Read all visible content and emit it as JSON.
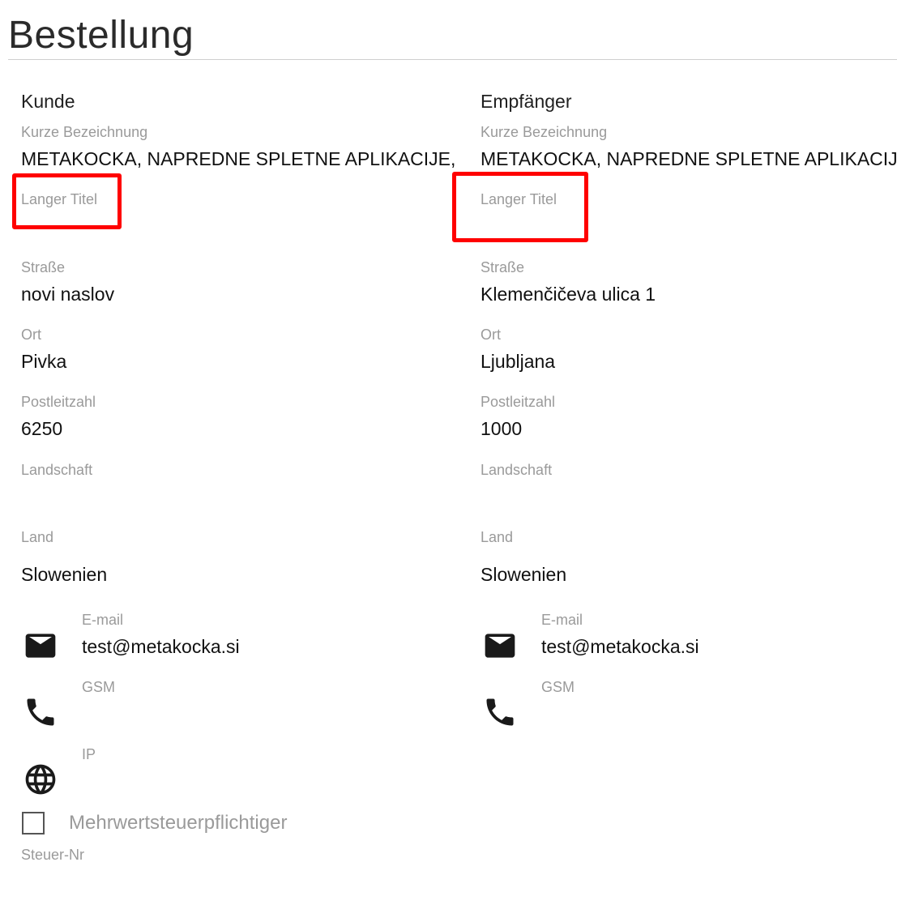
{
  "page": {
    "title": "Bestellung"
  },
  "customer": {
    "heading": "Kunde",
    "short_name_label": "Kurze Bezeichnung",
    "short_name": "METAKOCKA, NAPREDNE SPLETNE APLIKACIJE,",
    "long_title_label": "Langer Titel",
    "long_title": "",
    "street_label": "Straße",
    "street": "novi naslov",
    "city_label": "Ort",
    "city": "Pivka",
    "zip_label": "Postleitzahl",
    "zip": "6250",
    "region_label": "Landschaft",
    "region": "",
    "country_label": "Land",
    "country": "Slowenien",
    "email_label": "E-mail",
    "email": "test@metakocka.si",
    "gsm_label": "GSM",
    "gsm": "",
    "ip_label": "IP",
    "ip": "",
    "vat_checkbox_label": "Mehrwertsteuerpflichtiger",
    "vat_checked": false,
    "tax_no_label": "Steuer-Nr"
  },
  "recipient": {
    "heading": "Empfänger",
    "short_name_label": "Kurze Bezeichnung",
    "short_name": "METAKOCKA, NAPREDNE SPLETNE APLIKACIJE,",
    "long_title_label": "Langer Titel",
    "long_title": "",
    "street_label": "Straße",
    "street": "Klemenčičeva ulica 1",
    "city_label": "Ort",
    "city": "Ljubljana",
    "zip_label": "Postleitzahl",
    "zip": "1000",
    "region_label": "Landschaft",
    "region": "",
    "country_label": "Land",
    "country": "Slowenien",
    "email_label": "E-mail",
    "email": "test@metakocka.si",
    "gsm_label": "GSM",
    "gsm": ""
  },
  "icons": {
    "email": "email-icon",
    "phone": "phone-icon",
    "globe": "globe-icon"
  },
  "colors": {
    "highlight": "#ff0000",
    "label": "#9a9a9a",
    "text": "#111111"
  }
}
